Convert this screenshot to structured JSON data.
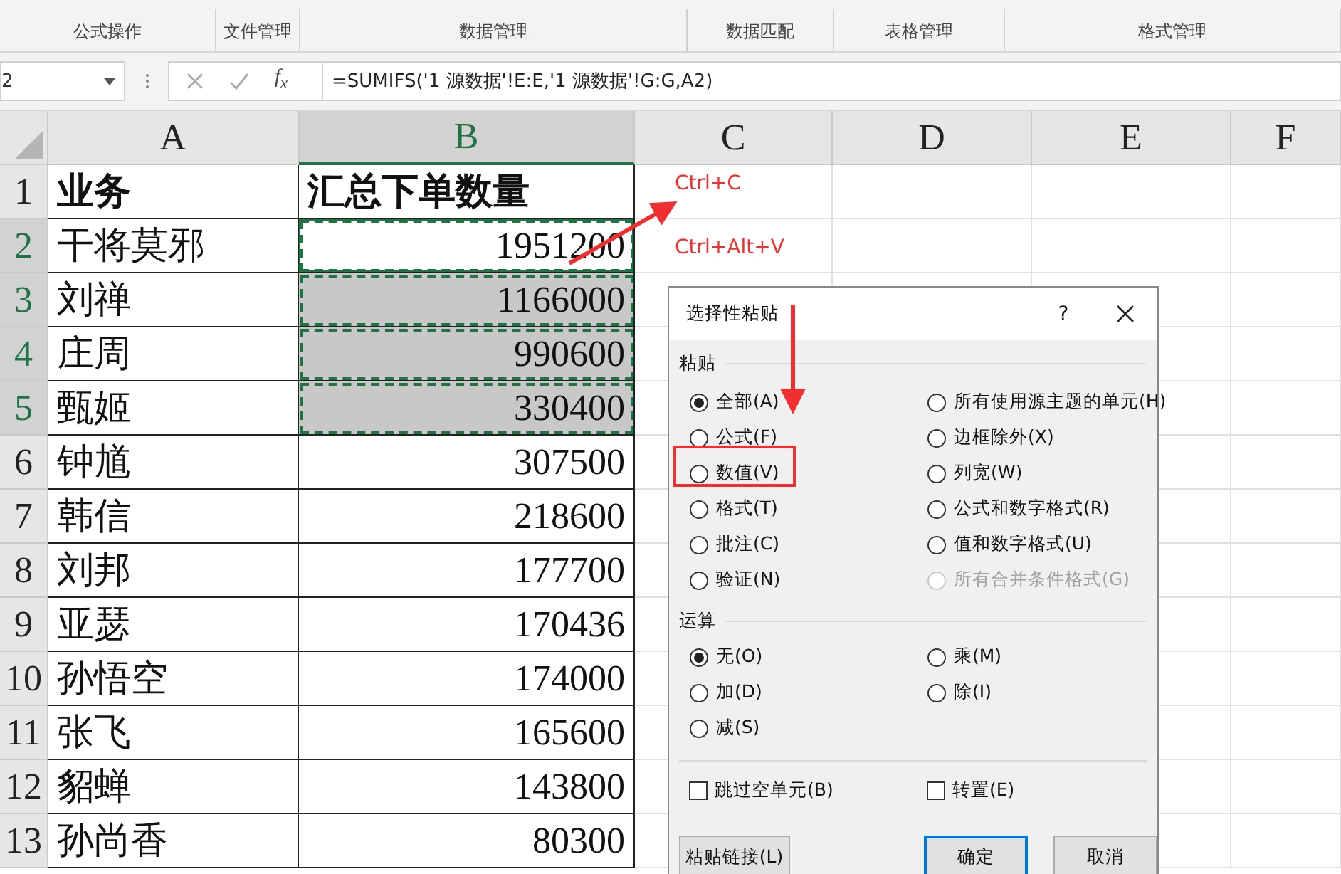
{
  "ribbon_groups": [
    {
      "label": "公式操作"
    },
    {
      "label": "文件管理"
    },
    {
      "label": "数据管理"
    },
    {
      "label": "数据匹配"
    },
    {
      "label": "表格管理"
    },
    {
      "label": "格式管理"
    }
  ],
  "formula_bar": {
    "name_box": "2",
    "function_icon": "f$_{x}$",
    "formula": "=SUMIFS('1 源数据'!E:E,'1 源数据'!G:G,A2)"
  },
  "columns": [
    {
      "label": "A",
      "selected": false
    },
    {
      "label": "B",
      "selected": true
    },
    {
      "label": "C",
      "selected": false
    },
    {
      "label": "D",
      "selected": false
    },
    {
      "label": "E",
      "selected": false
    },
    {
      "label": "F",
      "selected": false
    }
  ],
  "rows": [
    {
      "number": "1",
      "kind": "header",
      "selected": false,
      "active": false,
      "cells": [
        "业务",
        "汇总下单数量"
      ]
    },
    {
      "number": "2",
      "kind": "data",
      "selected": true,
      "active": true,
      "cells": [
        "干将莫邪",
        "1951200"
      ]
    },
    {
      "number": "3",
      "kind": "data",
      "selected": true,
      "active": false,
      "cells": [
        "刘禅",
        "1166000"
      ]
    },
    {
      "number": "4",
      "kind": "data",
      "selected": true,
      "active": false,
      "cells": [
        "庄周",
        "990600"
      ]
    },
    {
      "number": "5",
      "kind": "data",
      "selected": true,
      "active": false,
      "cells": [
        "甄姬",
        "330400"
      ]
    },
    {
      "number": "6",
      "kind": "data",
      "selected": false,
      "active": false,
      "cells": [
        "钟馗",
        "307500"
      ]
    },
    {
      "number": "7",
      "kind": "data",
      "selected": false,
      "active": false,
      "cells": [
        "韩信",
        "218600"
      ]
    },
    {
      "number": "8",
      "kind": "data",
      "selected": false,
      "active": false,
      "cells": [
        "刘邦",
        "177700"
      ]
    },
    {
      "number": "9",
      "kind": "data",
      "selected": false,
      "active": false,
      "cells": [
        "亚瑟",
        "170436"
      ]
    },
    {
      "number": "10",
      "kind": "data",
      "selected": false,
      "active": false,
      "cells": [
        "孙悟空",
        "174000"
      ]
    },
    {
      "number": "11",
      "kind": "data",
      "selected": false,
      "active": false,
      "cells": [
        "张飞",
        "165600"
      ]
    },
    {
      "number": "12",
      "kind": "data",
      "selected": false,
      "active": false,
      "cells": [
        "貂蝉",
        "143800"
      ]
    },
    {
      "number": "13",
      "kind": "data",
      "selected": false,
      "active": false,
      "cells": [
        "孙尚香",
        "80300"
      ]
    }
  ],
  "annotations": [
    {
      "text": "Ctrl+C"
    },
    {
      "text": "Ctrl+Alt+V"
    }
  ],
  "dialog": {
    "title": "选择性粘贴",
    "help": "?",
    "paste": {
      "label": "粘贴",
      "options": [
        {
          "label": "全部(A)",
          "selected": true,
          "disabled": false
        },
        {
          "label": "所有使用源主题的单元(H)",
          "selected": false,
          "disabled": false
        },
        {
          "label": "公式(F)",
          "selected": false,
          "disabled": false
        },
        {
          "label": "边框除外(X)",
          "selected": false,
          "disabled": false
        },
        {
          "label": "数值(V)",
          "selected": false,
          "disabled": false
        },
        {
          "label": "列宽(W)",
          "selected": false,
          "disabled": false
        },
        {
          "label": "格式(T)",
          "selected": false,
          "disabled": false
        },
        {
          "label": "公式和数字格式(R)",
          "selected": false,
          "disabled": false
        },
        {
          "label": "批注(C)",
          "selected": false,
          "disabled": false
        },
        {
          "label": "值和数字格式(U)",
          "selected": false,
          "disabled": false
        },
        {
          "label": "验证(N)",
          "selected": false,
          "disabled": false
        },
        {
          "label": "所有合并条件格式(G)",
          "selected": false,
          "disabled": true
        }
      ]
    },
    "operation": {
      "label": "运算",
      "options": [
        {
          "label": "无(O)",
          "selected": true,
          "disabled": false
        },
        {
          "label": "乘(M)",
          "selected": false,
          "disabled": false
        },
        {
          "label": "加(D)",
          "selected": false,
          "disabled": false
        },
        {
          "label": "除(I)",
          "selected": false,
          "disabled": false
        },
        {
          "label": "减(S)",
          "selected": false,
          "disabled": false
        }
      ]
    },
    "checkboxes": [
      {
        "label": "跳过空单元(B)",
        "checked": false
      },
      {
        "label": "转置(E)",
        "checked": false
      }
    ],
    "buttons": [
      {
        "label": "粘贴链接(L)",
        "default": false
      },
      {
        "label": "确定",
        "default": true
      },
      {
        "label": "取消",
        "default": false
      }
    ]
  }
}
